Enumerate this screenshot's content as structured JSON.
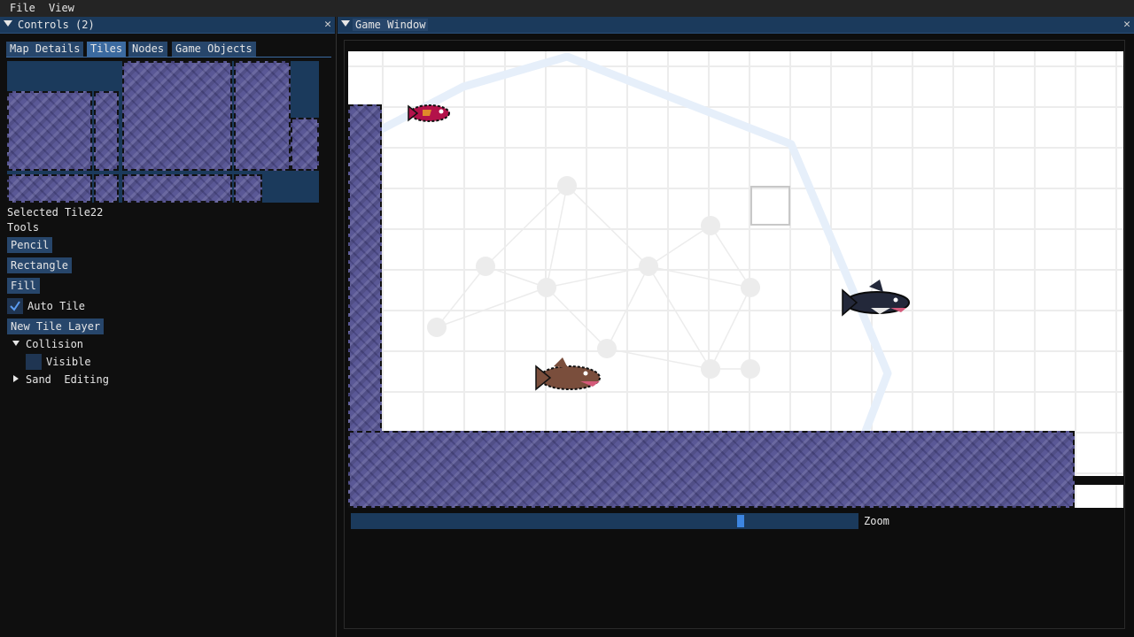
{
  "menubar": {
    "file": "File",
    "view": "View"
  },
  "controls": {
    "title": "Controls (2)",
    "tabs": [
      "Map Details",
      "Tiles",
      "Nodes",
      "Game Objects"
    ],
    "active_tab": "Tiles",
    "selected_tile": "Selected Tile22",
    "tools_label": "Tools",
    "tools": {
      "pencil": "Pencil",
      "rectangle": "Rectangle",
      "fill": "Fill"
    },
    "auto_tile": {
      "label": "Auto Tile",
      "checked": true
    },
    "new_layer": "New Tile Layer",
    "layers": [
      {
        "name": "Collision",
        "expanded": true,
        "visible_label": "Visible",
        "visible": false
      },
      {
        "name": "Sand  Editing",
        "expanded": false
      }
    ]
  },
  "game": {
    "title": "Game Window",
    "zoom_label": "Zoom",
    "zoom_value": 0.76
  },
  "colors": {
    "accent": "#1b3a5c",
    "button": "#27466b",
    "rock": "#5a5896",
    "slider_grab": "#3d85e0"
  }
}
